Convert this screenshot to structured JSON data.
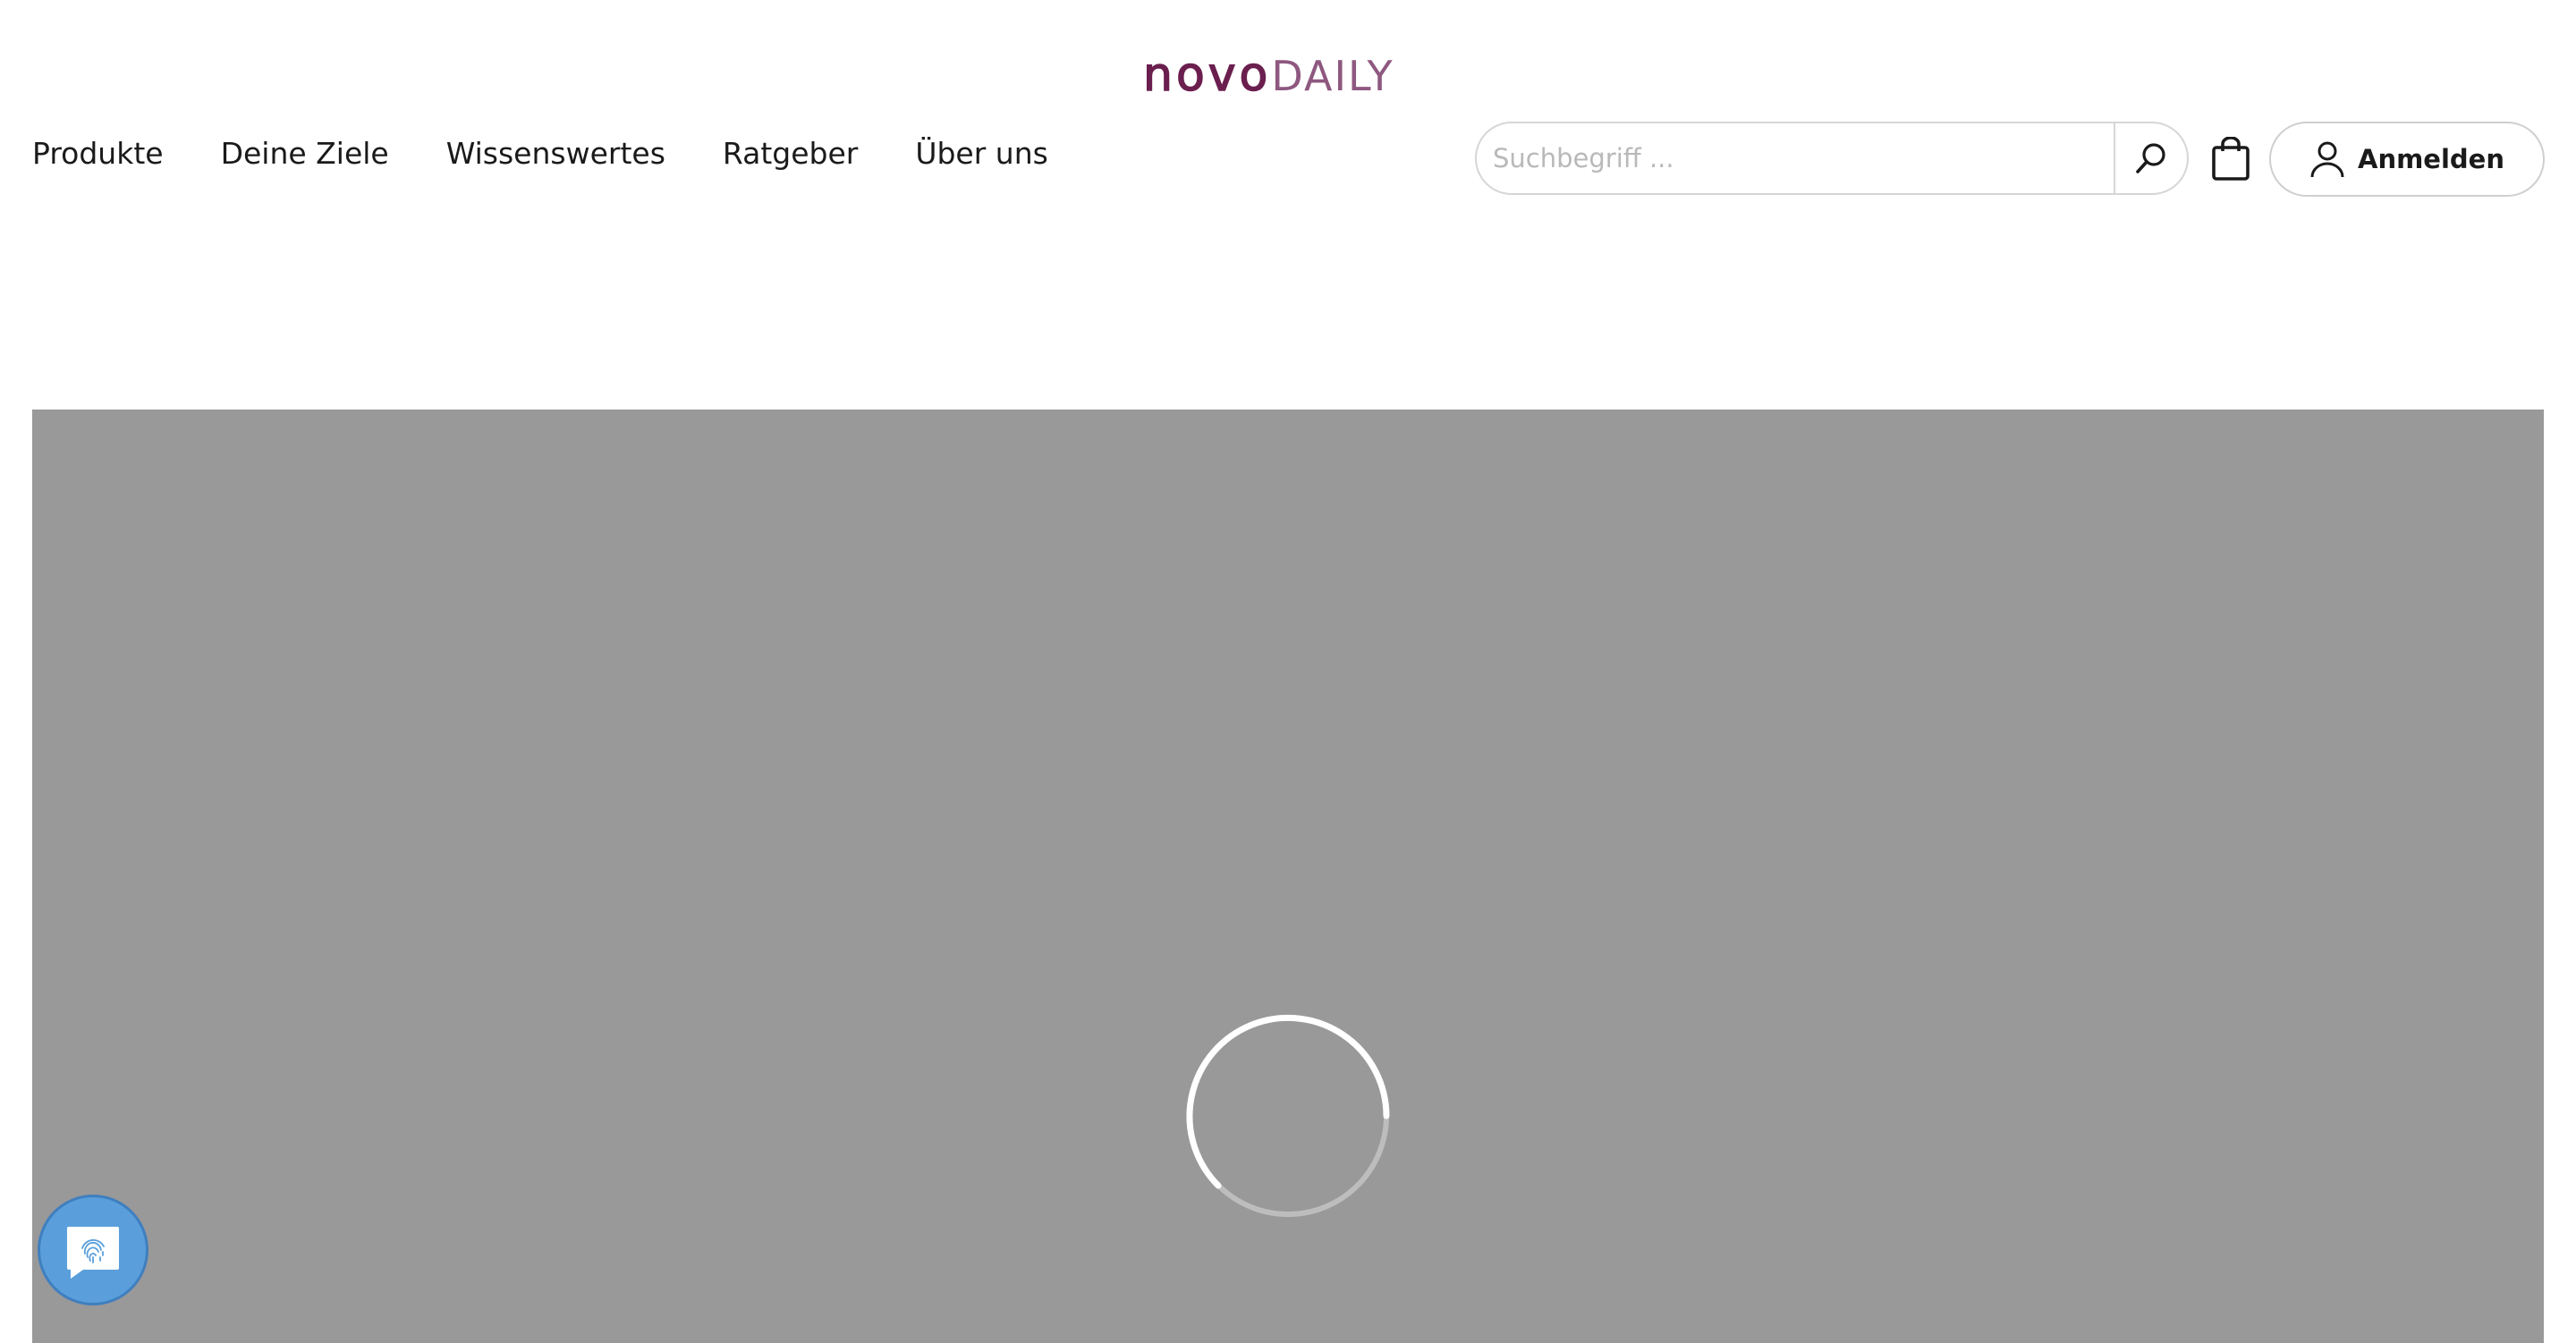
{
  "brand": {
    "name_part1": "novo",
    "name_part2": "DAILY",
    "primary_color": "#6b1f4f",
    "secondary_color": "#8e5880"
  },
  "nav": {
    "items": [
      {
        "label": "Produkte"
      },
      {
        "label": "Deine Ziele"
      },
      {
        "label": "Wissenswertes"
      },
      {
        "label": "Ratgeber"
      },
      {
        "label": "Über uns"
      }
    ]
  },
  "search": {
    "placeholder": "Suchbegriff ...",
    "value": "",
    "icon": "search-icon"
  },
  "cart": {
    "icon": "shopping-bag-icon"
  },
  "account": {
    "login_label": "Anmelden",
    "icon": "user-icon"
  },
  "hero": {
    "state": "loading",
    "background_color": "#999999",
    "spinner_icon": "loading-spinner-icon"
  },
  "chat_widget": {
    "icon": "fingerprint-chat-icon",
    "color": "#5a9fdc"
  }
}
